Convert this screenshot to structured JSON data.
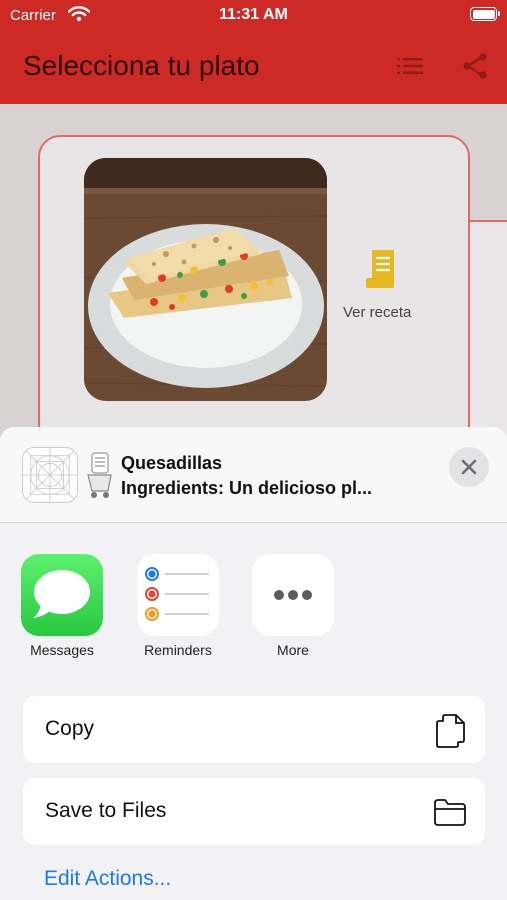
{
  "status_bar": {
    "carrier": "Carrier",
    "time": "11:31 AM"
  },
  "app_bar": {
    "title": "Selecciona tu plato",
    "list_icon": "list-icon",
    "share_icon": "share-icon"
  },
  "card": {
    "recipe_label": "Ver receta",
    "recipe_icon": "receipt-icon",
    "dish_image": "quesadillas-photo"
  },
  "share_sheet": {
    "title": "Quesadillas",
    "subtitle": "Ingredients: Un delicioso pl...",
    "apps": [
      {
        "label": "Messages",
        "icon": "messages-icon"
      },
      {
        "label": "Reminders",
        "icon": "reminders-icon"
      },
      {
        "label": "More",
        "icon": "more-icon"
      }
    ],
    "actions": [
      {
        "label": "Copy",
        "icon": "copy-icon"
      },
      {
        "label": "Save to Files",
        "icon": "folder-icon"
      }
    ],
    "edit_actions": "Edit Actions..."
  },
  "colors": {
    "app_bar": "#cd2a26",
    "accent_yellow": "#e6b821",
    "link_blue": "#1e7ae6"
  }
}
